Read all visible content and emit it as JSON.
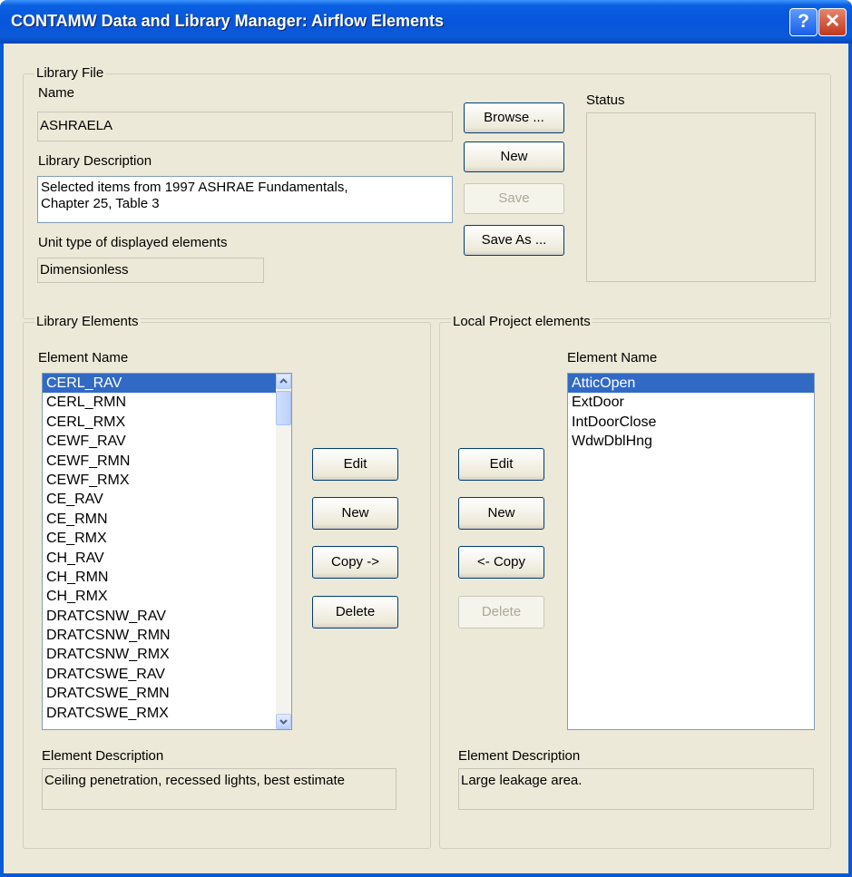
{
  "window": {
    "title": "CONTAMW Data and Library Manager: Airflow Elements",
    "help_glyph": "?",
    "close_glyph": "✕"
  },
  "library_file": {
    "group_title": "Library File",
    "name_label": "Name",
    "name_value": "ASHRAELA",
    "description_label": "Library Description",
    "description_value": "Selected items from 1997 ASHRAE Fundamentals,\nChapter 25, Table 3",
    "unit_label": "Unit type of displayed elements",
    "unit_value": "Dimensionless",
    "status_label": "Status",
    "status_value": "",
    "buttons": {
      "browse": "Browse ...",
      "new": "New",
      "save": "Save",
      "save_as": "Save As ..."
    }
  },
  "library_elements": {
    "group_title": "Library Elements",
    "list_header": "Element Name",
    "items": [
      "CERL_RAV",
      "CERL_RMN",
      "CERL_RMX",
      "CEWF_RAV",
      "CEWF_RMN",
      "CEWF_RMX",
      "CE_RAV",
      "CE_RMN",
      "CE_RMX",
      "CH_RAV",
      "CH_RMN",
      "CH_RMX",
      "DRATCSNW_RAV",
      "DRATCSNW_RMN",
      "DRATCSNW_RMX",
      "DRATCSWE_RAV",
      "DRATCSWE_RMN",
      "DRATCSWE_RMX"
    ],
    "selected_index": 0,
    "description_label": "Element Description",
    "description_value": "Ceiling penetration, recessed lights, best estimate"
  },
  "middle_buttons": {
    "edit": "Edit",
    "new": "New",
    "copy": "Copy ->",
    "delete": "Delete"
  },
  "local_elements": {
    "group_title": "Local Project elements",
    "list_header": "Element Name",
    "items": [
      "AtticOpen",
      "ExtDoor",
      "IntDoorClose",
      "WdwDblHng"
    ],
    "selected_index": 0,
    "description_label": "Element Description",
    "description_value": "Large leakage area.",
    "buttons": {
      "edit": "Edit",
      "new": "New",
      "copy": "<- Copy",
      "delete": "Delete"
    }
  },
  "colors": {
    "titlebar": "#0a5ad6",
    "dialog_bg": "#ece9d8",
    "selection": "#316ac5"
  }
}
